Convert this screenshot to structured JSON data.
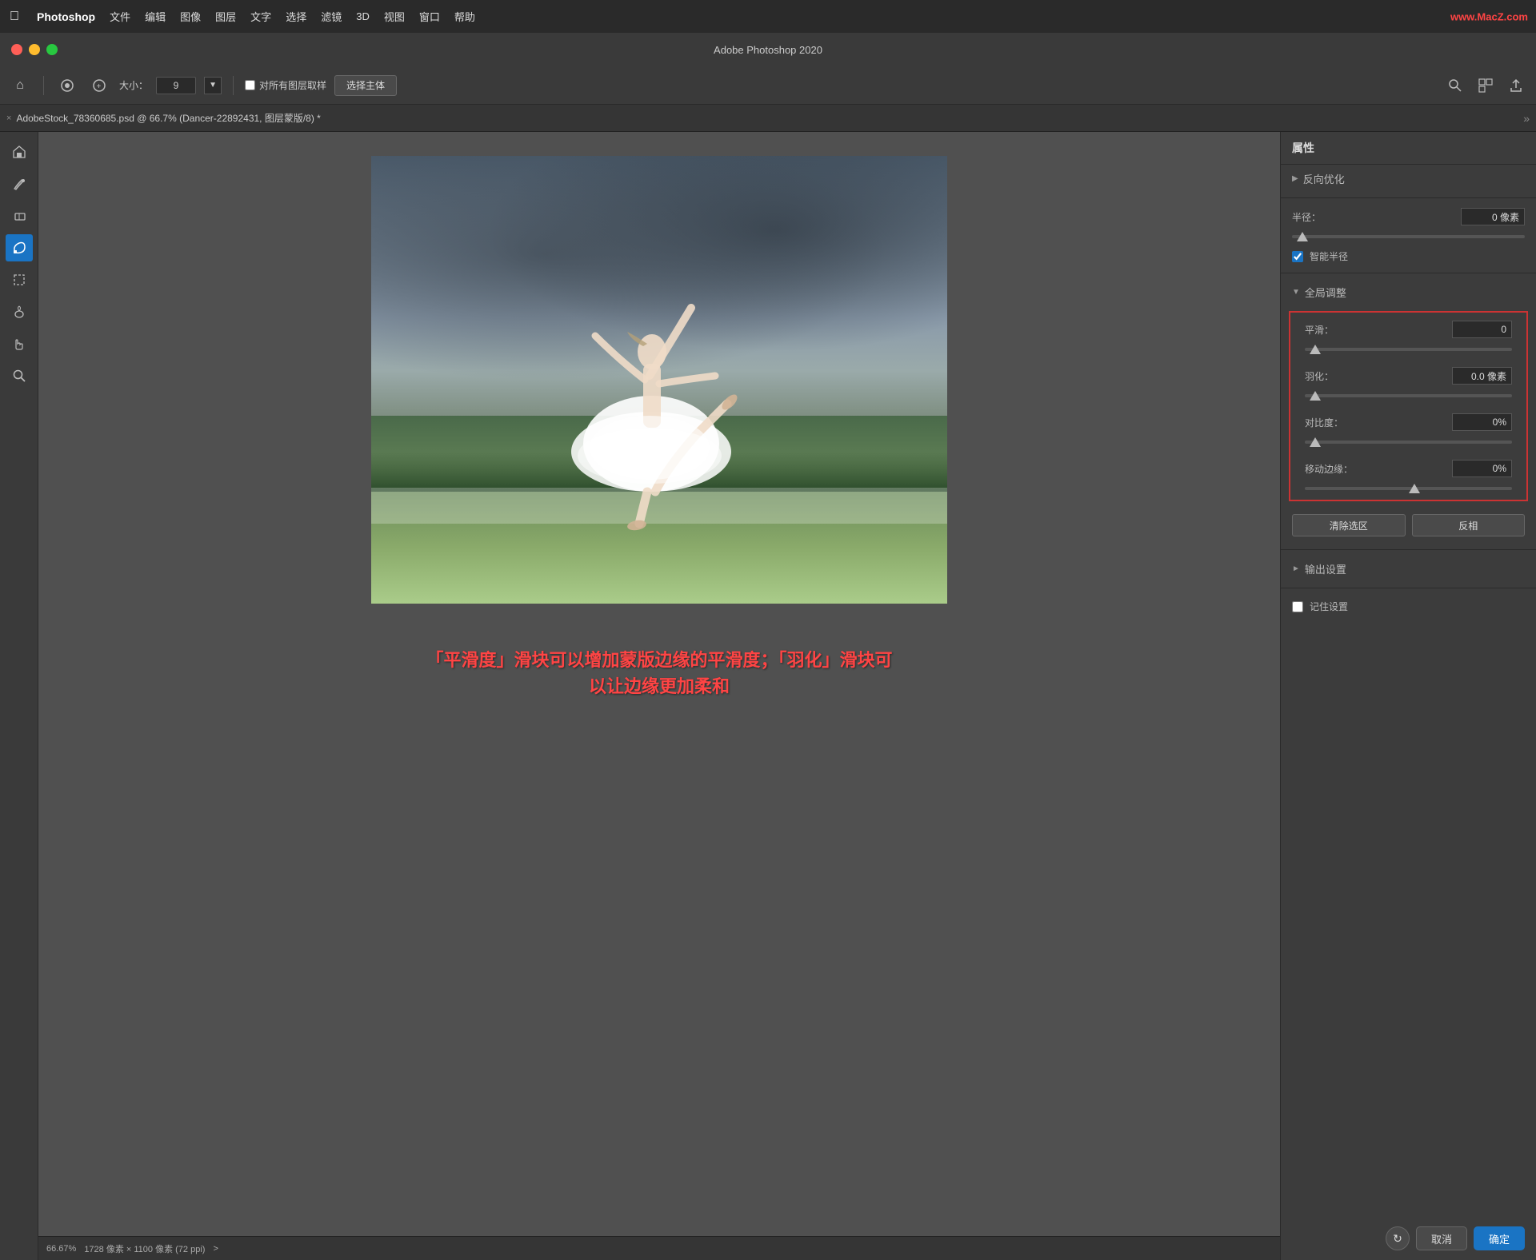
{
  "menubar": {
    "apple": "⌘",
    "app_name": "Photoshop",
    "items": [
      "文件",
      "编辑",
      "图像",
      "图层",
      "文字",
      "选择",
      "滤镜",
      "3D",
      "视图",
      "窗口",
      "帮助"
    ],
    "watermark": "www.MacZ.com"
  },
  "titlebar": {
    "title": "Adobe Photoshop 2020"
  },
  "toolbar": {
    "size_label": "大小：",
    "size_value": "9",
    "checkbox_label": "对所有图层取样",
    "subject_btn": "选择主体"
  },
  "tab": {
    "close": "×",
    "title": "AdobeStock_78360685.psd @ 66.7% (Dancer-22892431, 图层蒙版/8) *"
  },
  "panel": {
    "header": "属性",
    "section_collapsed": "反向优化",
    "radius_label": "半径：",
    "radius_value": "0 像素",
    "smart_radius_label": "智能半径",
    "global_adj_label": "全局调整",
    "smooth_label": "平滑：",
    "smooth_value": "0",
    "feather_label": "羽化：",
    "feather_value": "0.0 像素",
    "contrast_label": "对比度：",
    "contrast_value": "0%",
    "shift_edge_label": "移动边缘：",
    "shift_edge_value": "0%",
    "clear_selection_btn": "清除选区",
    "invert_btn": "反相",
    "output_label": "输出设置",
    "remember_label": "记住设置",
    "reset_tooltip": "重置",
    "cancel_btn": "取消",
    "ok_btn": "确定"
  },
  "status": {
    "zoom": "66.67%",
    "dimensions": "1728 像素 × 1100 像素 (72 ppi)",
    "arrow": ">"
  },
  "caption": {
    "line1": "「平滑度」滑块可以增加蒙版边缘的平滑度；「羽化」滑块可",
    "line2": "以让边缘更加柔和"
  }
}
